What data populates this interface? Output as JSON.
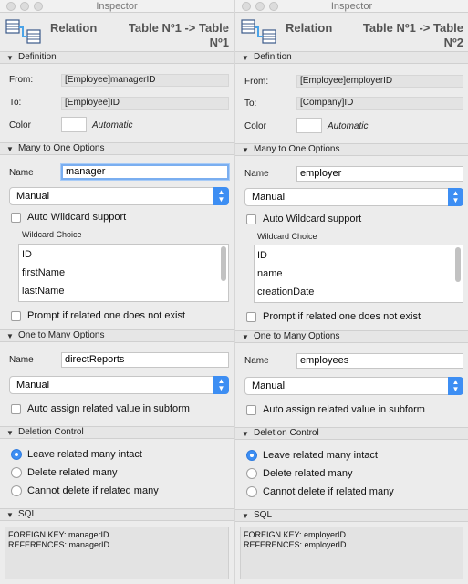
{
  "window": {
    "title": "Inspector"
  },
  "panels": [
    {
      "header": {
        "label": "Relation",
        "target": "Table Nº1 -> Table Nº1"
      },
      "definition": {
        "section_title": "Definition",
        "from_label": "From:",
        "from_value": "[Employee]managerID",
        "to_label": "To:",
        "to_value": "[Employee]ID",
        "color_label": "Color",
        "color_value": "Automatic"
      },
      "many_to_one": {
        "section_title": "Many to One Options",
        "name_label": "Name",
        "name_value": "manager",
        "mode": "Manual",
        "auto_wildcard_label": "Auto Wildcard support",
        "wildcard_title": "Wildcard Choice",
        "wildcard_items": [
          "ID",
          "firstName",
          "lastName"
        ],
        "prompt_label": "Prompt if related one does not exist"
      },
      "one_to_many": {
        "section_title": "One to Many Options",
        "name_label": "Name",
        "name_value": "directReports",
        "mode": "Manual",
        "auto_assign_label": "Auto assign related value in subform"
      },
      "deletion": {
        "section_title": "Deletion Control",
        "options": [
          "Leave related many intact",
          "Delete related many",
          "Cannot delete if related many"
        ],
        "selected": 0
      },
      "sql": {
        "section_title": "SQL",
        "line1": "FOREIGN KEY: managerID",
        "line2": "REFERENCES: managerID"
      }
    },
    {
      "header": {
        "label": "Relation",
        "target": "Table Nº1 -> Table Nº2"
      },
      "definition": {
        "section_title": "Definition",
        "from_label": "From:",
        "from_value": "[Employee]employerID",
        "to_label": "To:",
        "to_value": "[Company]ID",
        "color_label": "Color",
        "color_value": "Automatic"
      },
      "many_to_one": {
        "section_title": "Many to One Options",
        "name_label": "Name",
        "name_value": "employer",
        "mode": "Manual",
        "auto_wildcard_label": "Auto Wildcard support",
        "wildcard_title": "Wildcard Choice",
        "wildcard_items": [
          "ID",
          "name",
          "creationDate"
        ],
        "prompt_label": "Prompt if related one does not exist"
      },
      "one_to_many": {
        "section_title": "One to Many Options",
        "name_label": "Name",
        "name_value": "employees",
        "mode": "Manual",
        "auto_assign_label": "Auto assign related value in subform"
      },
      "deletion": {
        "section_title": "Deletion Control",
        "options": [
          "Leave related many intact",
          "Delete related many",
          "Cannot delete if related many"
        ],
        "selected": 0
      },
      "sql": {
        "section_title": "SQL",
        "line1": "FOREIGN KEY: employerID",
        "line2": "REFERENCES: employerID"
      }
    }
  ],
  "colors": {
    "accent": "#3d8ef3",
    "focus_ring": "#7aaef0"
  }
}
